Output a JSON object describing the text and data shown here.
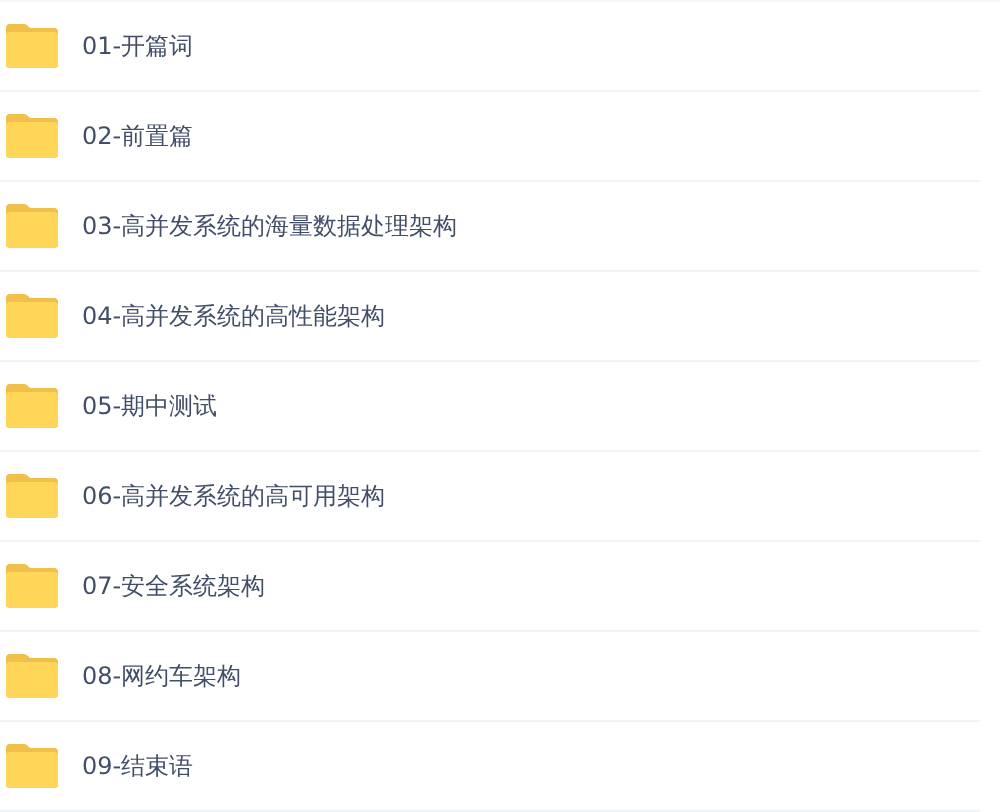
{
  "folders": [
    {
      "name": "01-开篇词"
    },
    {
      "name": "02-前置篇"
    },
    {
      "name": "03-高并发系统的海量数据处理架构"
    },
    {
      "name": "04-高并发系统的高性能架构"
    },
    {
      "name": "05-期中测试"
    },
    {
      "name": "06-高并发系统的高可用架构"
    },
    {
      "name": "07-安全系统架构"
    },
    {
      "name": "08-网约车架构"
    },
    {
      "name": "09-结束语"
    }
  ]
}
